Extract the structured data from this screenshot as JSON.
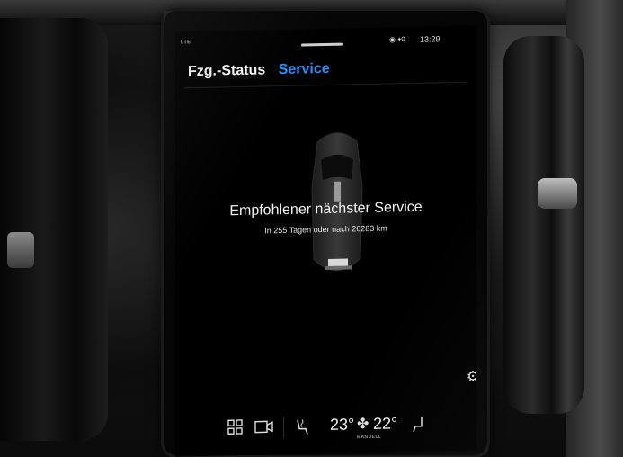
{
  "status_bar": {
    "network": "LTE",
    "icons": "◉ ♦0",
    "time": "13:29"
  },
  "tabs": [
    {
      "label": "Fzg.-Status",
      "selected": false
    },
    {
      "label": "Service",
      "selected": true
    }
  ],
  "service": {
    "title": "Empfohlener nächster Service",
    "detail": "In 255 Tagen oder nach 26283 km"
  },
  "climate": {
    "temp_left": "23°",
    "temp_right": "22°",
    "mode": "MANUELL"
  },
  "icons": {
    "settings": "gear-icon",
    "apps": "grid-icon",
    "camera": "camera-icon",
    "seat_left": "seat-heat-icon",
    "fan": "fan-icon",
    "seat_right": "seat-icon"
  },
  "colors": {
    "accent": "#2f8ef5",
    "screen_bg": "#000000",
    "text": "#f2f2f2"
  }
}
